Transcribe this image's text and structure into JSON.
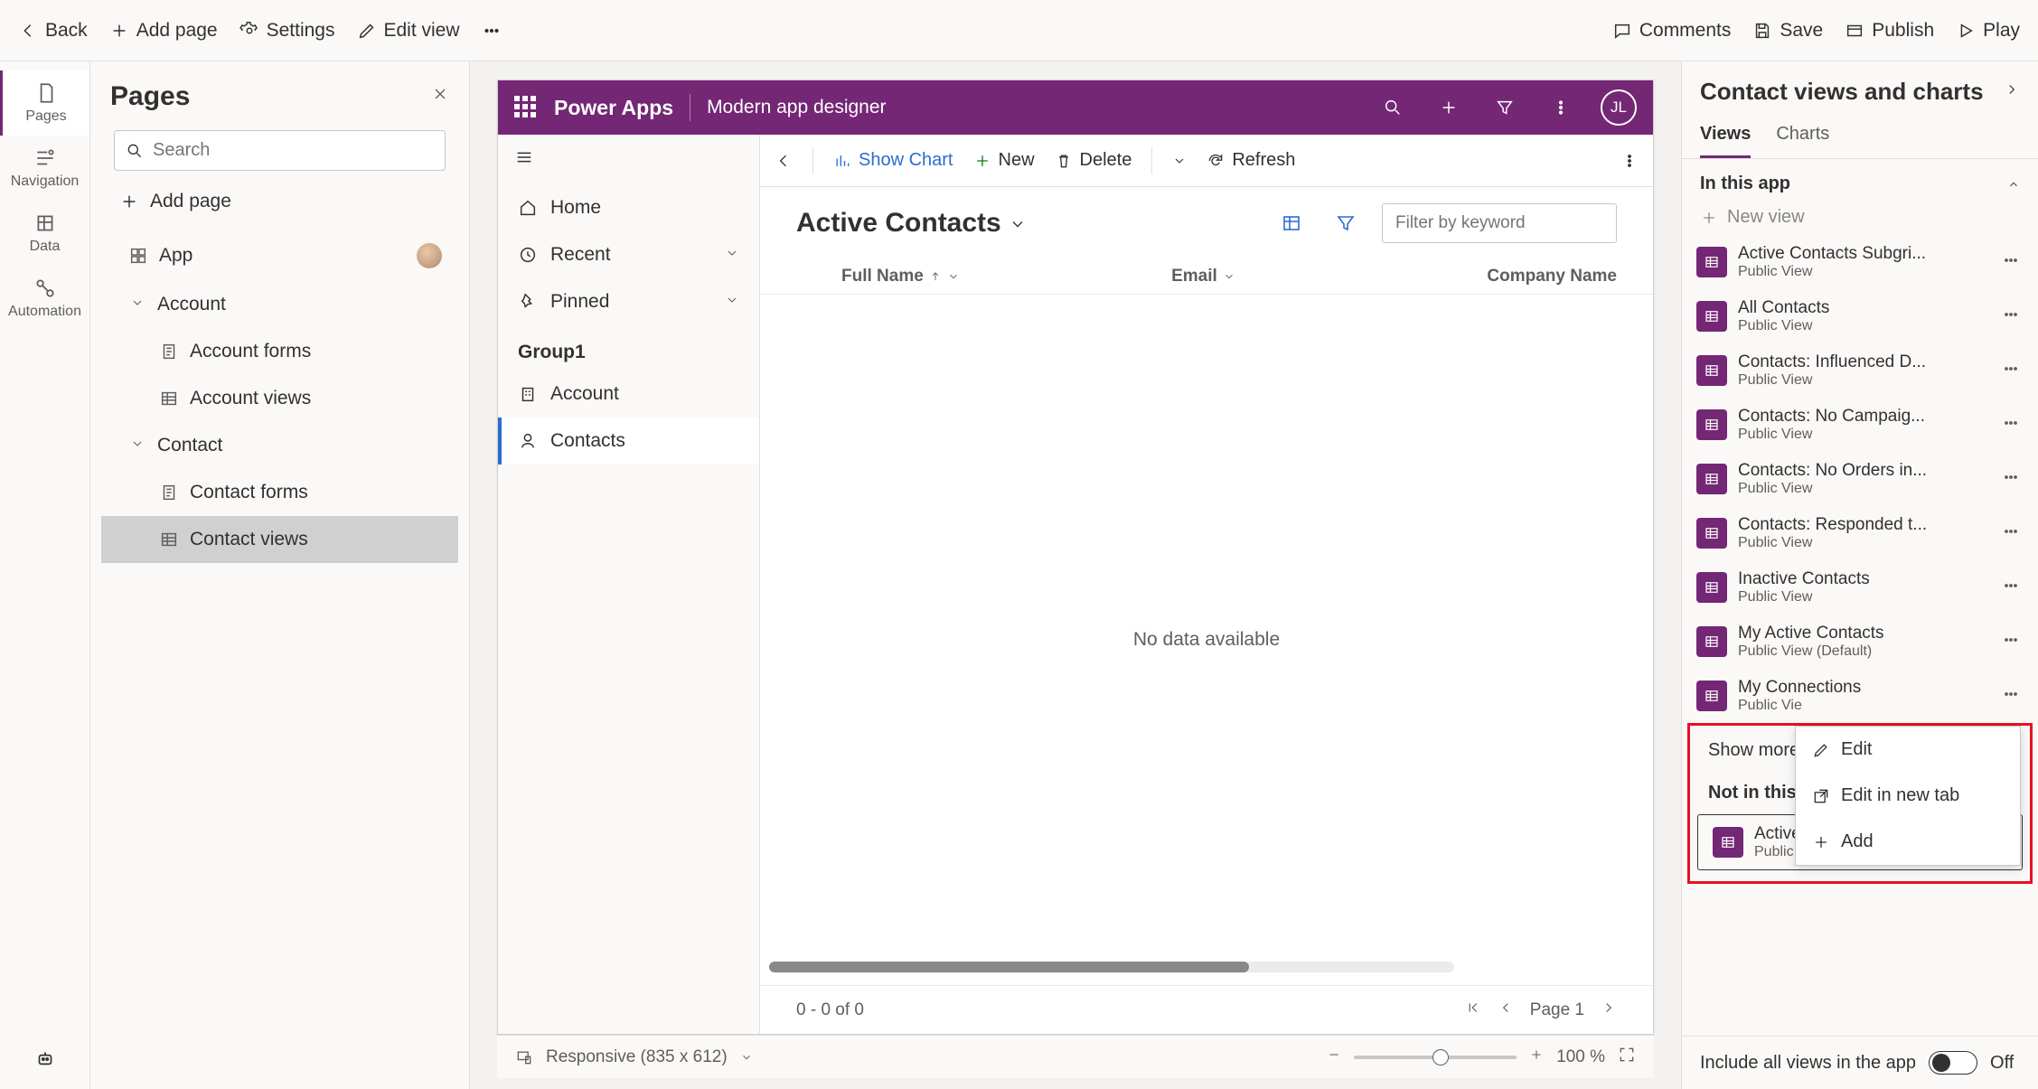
{
  "toolbar": {
    "back": "Back",
    "add_page": "Add page",
    "settings": "Settings",
    "edit_view": "Edit view",
    "comments": "Comments",
    "save": "Save",
    "publish": "Publish",
    "play": "Play"
  },
  "rail": {
    "pages": "Pages",
    "navigation": "Navigation",
    "data": "Data",
    "automation": "Automation"
  },
  "pages_panel": {
    "title": "Pages",
    "search_placeholder": "Search",
    "add_page": "Add page",
    "tree": {
      "app": "App",
      "account": "Account",
      "account_forms": "Account forms",
      "account_views": "Account views",
      "contact": "Contact",
      "contact_forms": "Contact forms",
      "contact_views": "Contact views"
    }
  },
  "app": {
    "brand": "Power Apps",
    "title": "Modern app designer",
    "avatar": "JL",
    "sidebar": {
      "home": "Home",
      "recent": "Recent",
      "pinned": "Pinned",
      "group": "Group1",
      "account": "Account",
      "contacts": "Contacts"
    },
    "cmdbar": {
      "show_chart": "Show Chart",
      "new": "New",
      "delete": "Delete",
      "refresh": "Refresh"
    },
    "view": {
      "name": "Active Contacts",
      "filter_placeholder": "Filter by keyword",
      "columns": {
        "full_name": "Full Name",
        "email": "Email",
        "company": "Company Name"
      },
      "empty": "No data available",
      "record_count": "0 - 0 of 0",
      "page": "Page 1"
    }
  },
  "right_panel": {
    "title": "Contact views and charts",
    "tabs": {
      "views": "Views",
      "charts": "Charts"
    },
    "section_in_app": "In this app",
    "new_view": "New view",
    "views": [
      {
        "name": "Active Contacts Subgri...",
        "sub": "Public View"
      },
      {
        "name": "All Contacts",
        "sub": "Public View"
      },
      {
        "name": "Contacts: Influenced D...",
        "sub": "Public View"
      },
      {
        "name": "Contacts: No Campaig...",
        "sub": "Public View"
      },
      {
        "name": "Contacts: No Orders in...",
        "sub": "Public View"
      },
      {
        "name": "Contacts: Responded t...",
        "sub": "Public View"
      },
      {
        "name": "Inactive Contacts",
        "sub": "Public View"
      },
      {
        "name": "My Active Contacts",
        "sub": "Public View (Default)"
      },
      {
        "name": "My Connections",
        "sub": "Public Vie"
      }
    ],
    "show_more": "Show more",
    "section_not_in_app": "Not in this a",
    "not_in_app_view": {
      "name": "Active Contacts",
      "sub": "Public View"
    },
    "context_menu": {
      "edit": "Edit",
      "edit_new_tab": "Edit in new tab",
      "add": "Add"
    },
    "toggle_label": "Include all views in the app",
    "toggle_value": "Off"
  },
  "statusbar": {
    "responsive": "Responsive (835 x 612)",
    "zoom": "100 %"
  }
}
